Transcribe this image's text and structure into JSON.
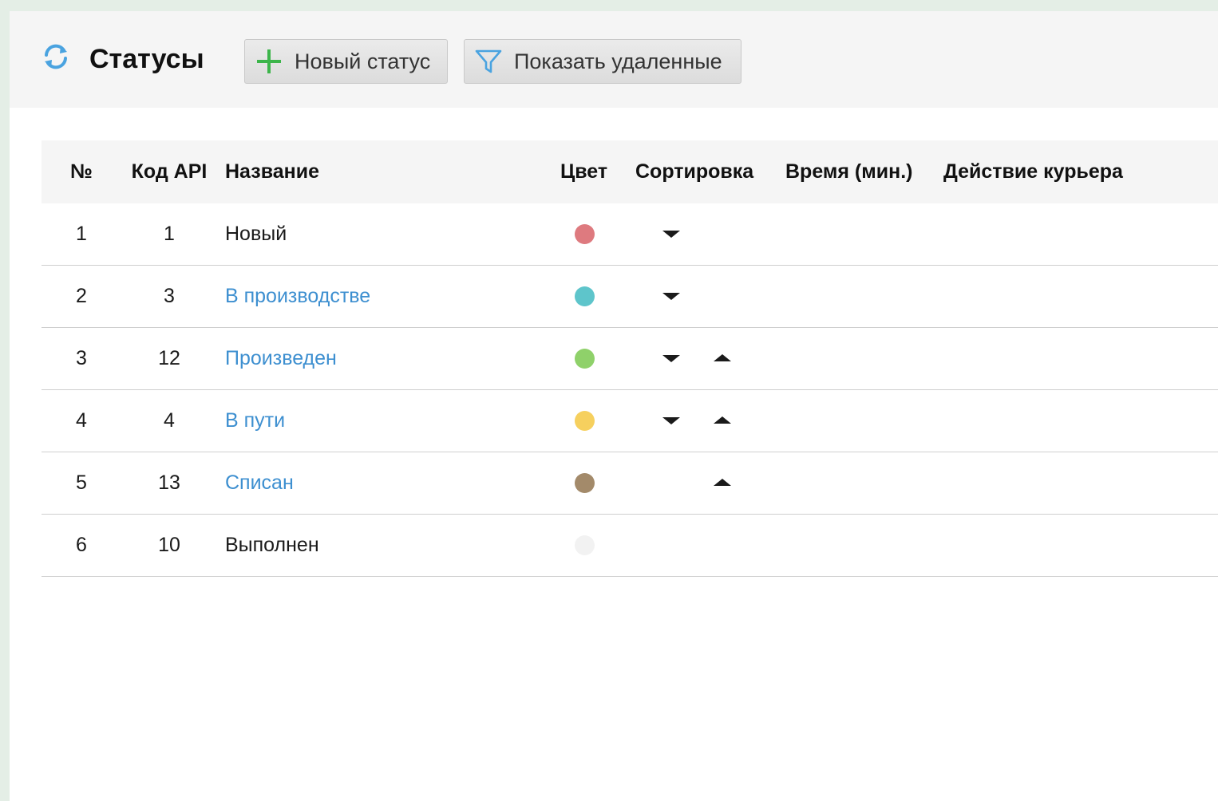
{
  "header": {
    "title": "Статусы",
    "refresh_icon": "refresh-icon",
    "new_status_label": "Новый статус",
    "new_status_icon": "plus-icon",
    "show_deleted_label": "Показать удаленные",
    "show_deleted_icon": "filter-icon",
    "plus_color": "#3cb54a",
    "accent_color": "#3d8fd0"
  },
  "table": {
    "columns": {
      "num": "№",
      "api_code": "Код API",
      "name": "Название",
      "color": "Цвет",
      "sort": "Сортировка",
      "time": "Время (мин.)",
      "courier_action": "Действие курьера"
    },
    "rows": [
      {
        "num": "1",
        "api_code": "1",
        "name": "Новый",
        "is_link": false,
        "color": "#de7a7f",
        "sort_down": true,
        "sort_up": false
      },
      {
        "num": "2",
        "api_code": "3",
        "name": "В производстве",
        "is_link": true,
        "color": "#5ec5cb",
        "sort_down": true,
        "sort_up": false
      },
      {
        "num": "3",
        "api_code": "12",
        "name": "Произведен",
        "is_link": true,
        "color": "#8fd16a",
        "sort_down": true,
        "sort_up": true
      },
      {
        "num": "4",
        "api_code": "4",
        "name": "В пути",
        "is_link": true,
        "color": "#f6d05e",
        "sort_down": true,
        "sort_up": true
      },
      {
        "num": "5",
        "api_code": "13",
        "name": "Списан",
        "is_link": true,
        "color": "#a38a6a",
        "sort_down": false,
        "sort_up": true
      },
      {
        "num": "6",
        "api_code": "10",
        "name": "Выполнен",
        "is_link": false,
        "color": "#f2f2f2",
        "sort_down": false,
        "sort_up": false
      }
    ]
  }
}
